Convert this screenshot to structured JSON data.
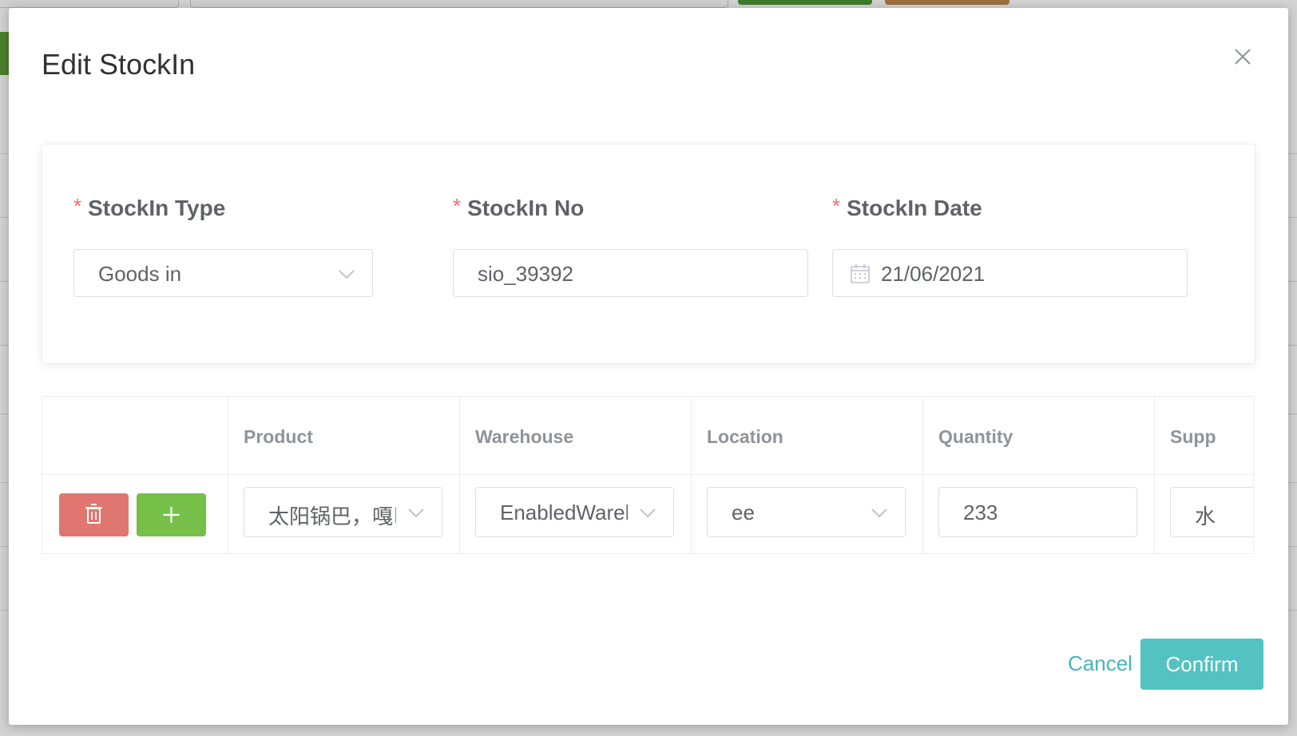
{
  "dialog": {
    "title": "Edit StockIn",
    "form": {
      "stockin_type": {
        "label": "StockIn Type",
        "value": "Goods in",
        "required_mark": "*"
      },
      "stockin_no": {
        "label": "StockIn No",
        "value": "sio_39392",
        "required_mark": "*"
      },
      "stockin_date": {
        "label": "StockIn Date",
        "value": "21/06/2021",
        "required_mark": "*"
      }
    },
    "table": {
      "columns": [
        "",
        "Product",
        "Warehouse",
        "Location",
        "Quantity",
        "Supp"
      ],
      "row": {
        "product": "太阳锅巴，嘎巴",
        "warehouse": "EnabledWarehouse",
        "location": "ee",
        "quantity": "233",
        "supplier": "水"
      }
    },
    "footer": {
      "cancel_label": "Cancel",
      "confirm_label": "Confirm"
    }
  },
  "colors": {
    "accent": "#53c2c0",
    "danger": "#e07670",
    "success": "#76c04a",
    "required": "#f56c6c"
  }
}
